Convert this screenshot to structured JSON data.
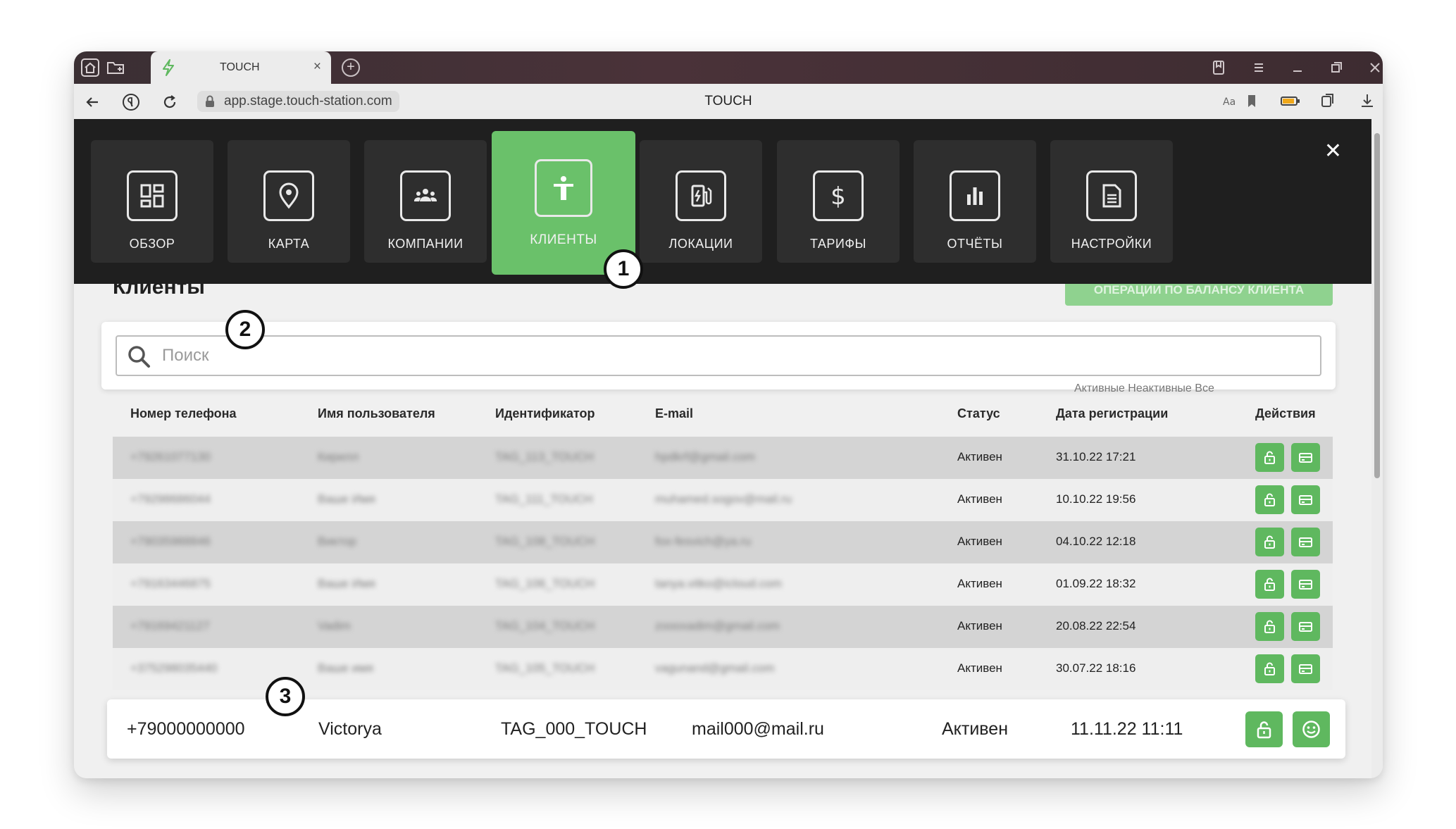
{
  "browser": {
    "tab_title": "TOUCH",
    "tab_close": "×",
    "new_tab": "+",
    "url": "app.stage.touch-station.com",
    "page_title": "TOUCH"
  },
  "menu": {
    "items": [
      {
        "label": "ОБЗОР",
        "icon": "dashboard-icon"
      },
      {
        "label": "КАРТА",
        "icon": "map-pin-icon"
      },
      {
        "label": "КОМПАНИИ",
        "icon": "group-icon"
      },
      {
        "label": "КЛИЕНТЫ",
        "icon": "person-icon",
        "active": true
      },
      {
        "label": "ЛОКАЦИИ",
        "icon": "charging-station-icon"
      },
      {
        "label": "ТАРИФЫ",
        "icon": "dollar-icon"
      },
      {
        "label": "ОТЧЁТЫ",
        "icon": "bar-chart-icon"
      },
      {
        "label": "НАСТРОЙКИ",
        "icon": "document-icon"
      }
    ],
    "close": "✕"
  },
  "page": {
    "title": "Клиенты",
    "balance_button": "ОПЕРАЦИИ ПО БАЛАНСУ КЛИЕНТА"
  },
  "search": {
    "placeholder": "Поиск"
  },
  "filters": {
    "text": "Активные   Неактивные   Все"
  },
  "table": {
    "headers": {
      "phone": "Номер телефона",
      "user": "Имя пользователя",
      "id": "Идентификатор",
      "email": "E-mail",
      "status": "Статус",
      "date": "Дата регистрации",
      "actions": "Действия"
    },
    "rows": [
      {
        "phone": "+79261077130",
        "user": "Кирилл",
        "id": "TAG_113_TOUCH",
        "email": "hpdkrf@gmail.com",
        "status": "Активен",
        "date": "31.10.22 17:21"
      },
      {
        "phone": "+79298686044",
        "user": "Ваше Имя",
        "id": "TAG_111_TOUCH",
        "email": "muhamed.sogov@mail.ru",
        "status": "Активен",
        "date": "10.10.22 19:56"
      },
      {
        "phone": "+79035988846",
        "user": "Виктор",
        "id": "TAG_108_TOUCH",
        "email": "fox-fesvich@ya.ru",
        "status": "Активен",
        "date": "04.10.22 12:18"
      },
      {
        "phone": "+79163446875",
        "user": "Ваше Имя",
        "id": "TAG_106_TOUCH",
        "email": "tanya.vitko@icloud.com",
        "status": "Активен",
        "date": "01.09.22 18:32"
      },
      {
        "phone": "+79169421127",
        "user": "Vadim",
        "id": "TAG_104_TOUCH",
        "email": "zoooxadim@gmail.com",
        "status": "Активен",
        "date": "20.08.22 22:54"
      },
      {
        "phone": "+375298035440",
        "user": "Ваше имя",
        "id": "TAG_105_TOUCH",
        "email": "vagunand@gmail.com",
        "status": "Активен",
        "date": "30.07.22 18:16"
      }
    ],
    "highlight": {
      "phone": "+79000000000",
      "user": "Victorya",
      "id": "TAG_000_TOUCH",
      "email": "mail000@mail.ru",
      "status": "Активен",
      "date": "11.11.22 11:11"
    }
  },
  "badges": {
    "one": "1",
    "two": "2",
    "three": "3"
  },
  "colors": {
    "accent": "#6ac16a",
    "action": "#5fb85f",
    "menu_bg": "#1f1f1f"
  }
}
